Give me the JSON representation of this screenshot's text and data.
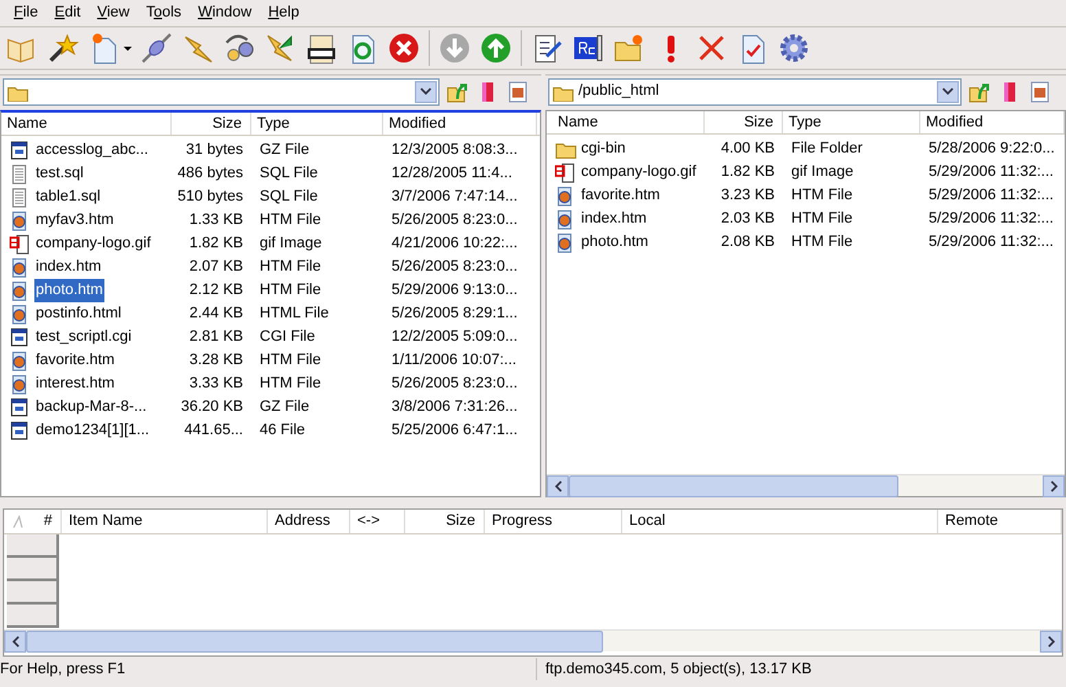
{
  "menu": [
    {
      "key": "F",
      "post": "ile"
    },
    {
      "key": "E",
      "post": "dit"
    },
    {
      "key": "V",
      "post": "iew"
    },
    {
      "pre": "T",
      "key": "o",
      "post": "ols"
    },
    {
      "key": "W",
      "post": "indow"
    },
    {
      "key": "H",
      "post": "elp"
    }
  ],
  "local_pane": {
    "columns": [
      "Name",
      "Size",
      "Type",
      "Modified"
    ],
    "rows": [
      {
        "kind": "archive",
        "name": "accesslog_abc...",
        "size": "31 bytes",
        "type": "GZ File",
        "modified": "12/3/2005 8:08:3...",
        "selected": false
      },
      {
        "kind": "text",
        "name": "test.sql",
        "size": "486 bytes",
        "type": "SQL File",
        "modified": "12/28/2005 11:4...",
        "selected": false
      },
      {
        "kind": "text",
        "name": "table1.sql",
        "size": "510 bytes",
        "type": "SQL File",
        "modified": "3/7/2006 7:47:14...",
        "selected": false
      },
      {
        "kind": "web",
        "name": "myfav3.htm",
        "size": "1.33 KB",
        "type": "HTM File",
        "modified": "5/26/2005 8:23:0...",
        "selected": false
      },
      {
        "kind": "image",
        "name": "company-logo.gif",
        "size": "1.82 KB",
        "type": "gif Image",
        "modified": "4/21/2006 10:22:...",
        "selected": false
      },
      {
        "kind": "web",
        "name": "index.htm",
        "size": "2.07 KB",
        "type": "HTM File",
        "modified": "5/26/2005 8:23:0...",
        "selected": false
      },
      {
        "kind": "web",
        "name": "photo.htm",
        "size": "2.12 KB",
        "type": "HTM File",
        "modified": "5/29/2006 9:13:0...",
        "selected": true
      },
      {
        "kind": "web",
        "name": "postinfo.html",
        "size": "2.44 KB",
        "type": "HTML File",
        "modified": "5/26/2005 8:29:1...",
        "selected": false
      },
      {
        "kind": "archive",
        "name": "test_scriptl.cgi",
        "size": "2.81 KB",
        "type": "CGI File",
        "modified": "12/2/2005 5:09:0...",
        "selected": false
      },
      {
        "kind": "web",
        "name": "favorite.htm",
        "size": "3.28 KB",
        "type": "HTM File",
        "modified": "1/11/2006 10:07:...",
        "selected": false
      },
      {
        "kind": "web",
        "name": "interest.htm",
        "size": "3.33 KB",
        "type": "HTM File",
        "modified": "5/26/2005 8:23:0...",
        "selected": false
      },
      {
        "kind": "archive",
        "name": "backup-Mar-8-...",
        "size": "36.20 KB",
        "type": "GZ File",
        "modified": "3/8/2006 7:31:26...",
        "selected": false
      },
      {
        "kind": "archive",
        "name": "demo1234[1][1...",
        "size": "441.65...",
        "type": "46 File",
        "modified": "5/25/2006 6:47:1...",
        "selected": false
      }
    ]
  },
  "remote_pane": {
    "path": "/public_html",
    "columns": [
      "Name",
      "Size",
      "Type",
      "Modified"
    ],
    "rows": [
      {
        "kind": "folder",
        "name": "cgi-bin",
        "size": "4.00 KB",
        "type": "File Folder",
        "modified": "5/28/2006 9:22:0...",
        "selected": false
      },
      {
        "kind": "image",
        "name": "company-logo.gif",
        "size": "1.82 KB",
        "type": "gif Image",
        "modified": "5/29/2006 11:32:...",
        "selected": false
      },
      {
        "kind": "web",
        "name": "favorite.htm",
        "size": "3.23 KB",
        "type": "HTM File",
        "modified": "5/29/2006 11:32:...",
        "selected": false
      },
      {
        "kind": "web",
        "name": "index.htm",
        "size": "2.03 KB",
        "type": "HTM File",
        "modified": "5/29/2006 11:32:...",
        "selected": false
      },
      {
        "kind": "web",
        "name": "photo.htm",
        "size": "2.08 KB",
        "type": "HTM File",
        "modified": "5/29/2006 11:32:...",
        "selected": false
      }
    ]
  },
  "queue": {
    "columns": [
      "#",
      "Item Name",
      "Address",
      "<->",
      "Size",
      "Progress",
      "Local",
      "Remote"
    ]
  },
  "status_bar": {
    "help": "For Help, press F1",
    "info": "ftp.demo345.com, 5 object(s), 13.17 KB"
  }
}
